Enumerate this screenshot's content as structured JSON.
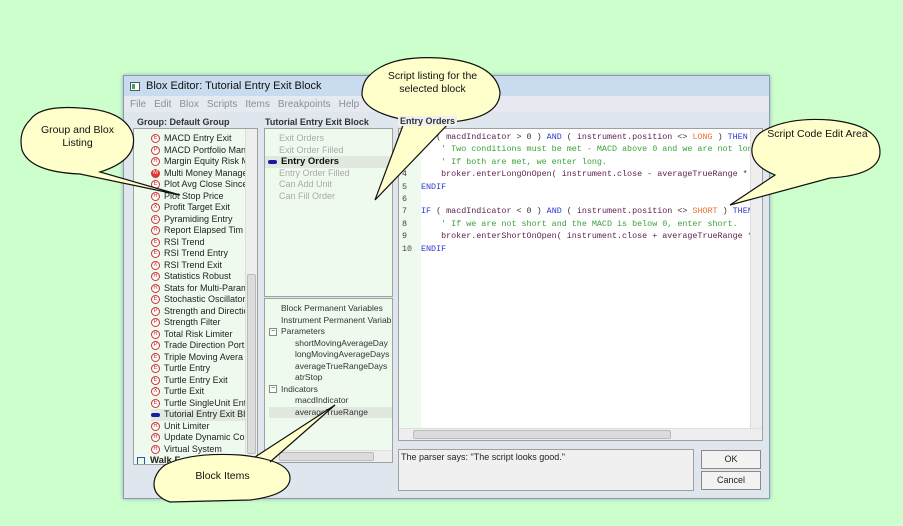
{
  "window": {
    "title": "Blox Editor: Tutorial Entry Exit Block",
    "menu": [
      "File",
      "Edit",
      "Blox",
      "Scripts",
      "Items",
      "Breakpoints",
      "Help"
    ]
  },
  "group": {
    "label": "Group: Default Group",
    "items": [
      {
        "icon": "E",
        "label": "MACD Entry Exit"
      },
      {
        "icon": "P",
        "label": "MACD Portfolio Mana"
      },
      {
        "icon": "R",
        "label": "Margin Equity Risk M"
      },
      {
        "icon": "M",
        "label": "Multi Money Manage",
        "red": true
      },
      {
        "icon": "E",
        "label": "Plot Avg Close Since"
      },
      {
        "icon": "R",
        "label": "Plot Stop Price"
      },
      {
        "icon": "X",
        "label": "Profit Target Exit"
      },
      {
        "icon": "E",
        "label": "Pyramiding Entry"
      },
      {
        "icon": "R",
        "label": "Report Elapsed Tim"
      },
      {
        "icon": "E",
        "label": "RSI Trend"
      },
      {
        "icon": "E",
        "label": "RSI Trend Entry"
      },
      {
        "icon": "X",
        "label": "RSI Trend Exit"
      },
      {
        "icon": "R",
        "label": "Statistics Robust"
      },
      {
        "icon": "R",
        "label": "Stats for Multi-Param"
      },
      {
        "icon": "E",
        "label": "Stochastic Oscillator"
      },
      {
        "icon": "P",
        "label": "Strength and Directio"
      },
      {
        "icon": "P",
        "label": "Strength Filter"
      },
      {
        "icon": "R",
        "label": "Total Risk Limiter"
      },
      {
        "icon": "P",
        "label": "Trade Direction Port"
      },
      {
        "icon": "E",
        "label": "Triple Moving Avera"
      },
      {
        "icon": "E",
        "label": "Turtle Entry"
      },
      {
        "icon": "E",
        "label": "Turtle Entry Exit"
      },
      {
        "icon": "X",
        "label": "Turtle Exit"
      },
      {
        "icon": "E",
        "label": "Turtle SingleUnit Ent"
      },
      {
        "icon": "arrow",
        "label": "Tutorial Entry Exit Blo",
        "selected": true
      },
      {
        "icon": "R",
        "label": "Unit Limiter"
      },
      {
        "icon": "R",
        "label": "Update Dynamic Co"
      },
      {
        "icon": "R",
        "label": "Virtual System"
      }
    ],
    "folder": "Walk Forward"
  },
  "block": {
    "label": "Tutorial Entry Exit Block",
    "scripts": [
      "Exit Orders",
      "Exit Order Filled",
      "Entry Orders",
      "Entry Order Filled",
      "Can Add Unit",
      "Can Fill Order"
    ],
    "active_script": "Entry Orders",
    "items": [
      {
        "t": "Block Permanent Variables",
        "lvl": 0
      },
      {
        "t": "Instrument Permanent Variab",
        "lvl": 0
      },
      {
        "t": "Parameters",
        "lvl": 0,
        "tog": "−"
      },
      {
        "t": "shortMovingAverageDay",
        "lvl": 1
      },
      {
        "t": "longMovingAverageDays",
        "lvl": 1
      },
      {
        "t": "averageTrueRangeDays",
        "lvl": 1
      },
      {
        "t": "atrStop",
        "lvl": 1
      },
      {
        "t": "Indicators",
        "lvl": 0,
        "tog": "−"
      },
      {
        "t": "macdIndicator",
        "lvl": 1
      },
      {
        "t": "averageTrueRange",
        "lvl": 1,
        "selected": true
      }
    ]
  },
  "editor": {
    "label": "Entry Orders",
    "lines": [
      [
        [
          "kw",
          "IF "
        ],
        [
          "pl",
          "( "
        ],
        [
          "id",
          "macdIndicator"
        ],
        [
          "pl",
          " > 0 ) "
        ],
        [
          "kw",
          "AND"
        ],
        [
          "pl",
          " ( "
        ],
        [
          "id",
          "instrument.position"
        ],
        [
          "pl",
          " <> "
        ],
        [
          "cn",
          "LONG"
        ],
        [
          "pl",
          " ) "
        ],
        [
          "kw",
          "THEN"
        ]
      ],
      [
        [
          "cm",
          "    ' Two conditions must be met - MACD above 0 and we are not long."
        ]
      ],
      [
        [
          "cm",
          "    ' If both are met, we enter long."
        ]
      ],
      [
        [
          "id",
          "    broker.enterLongOnOpen( instrument.close - averageTrueRange * atrStop )"
        ]
      ],
      [
        [
          "kw",
          "ENDIF"
        ]
      ],
      [],
      [
        [
          "kw",
          "IF "
        ],
        [
          "pl",
          "( "
        ],
        [
          "id",
          "macdIndicator"
        ],
        [
          "pl",
          " < 0 ) "
        ],
        [
          "kw",
          "AND"
        ],
        [
          "pl",
          " ( "
        ],
        [
          "id",
          "instrument.position"
        ],
        [
          "pl",
          " <> "
        ],
        [
          "cn",
          "SHORT"
        ],
        [
          "pl",
          " ) "
        ],
        [
          "kw",
          "THEN"
        ]
      ],
      [
        [
          "cm",
          "    ' If we are not short and the MACD is below 0, enter short."
        ]
      ],
      [
        [
          "id",
          "    broker.enterShortOnOpen( instrument.close + averageTrueRange * atrStop )"
        ]
      ],
      [
        [
          "kw",
          "ENDIF"
        ]
      ]
    ],
    "status": "The parser says: \"The script looks good.\""
  },
  "buttons": {
    "ok": "OK",
    "cancel": "Cancel"
  },
  "callouts": {
    "group": "Group and Blox Listing",
    "script": "Script listing for the selected block",
    "code": "Script Code Edit Area",
    "items": "Block Items"
  },
  "colors": {
    "background": "#ccffcc",
    "callout": "#ffffcc",
    "keyword": "#2a3acc",
    "comment": "#3aa23a",
    "constant": "#f07030"
  }
}
